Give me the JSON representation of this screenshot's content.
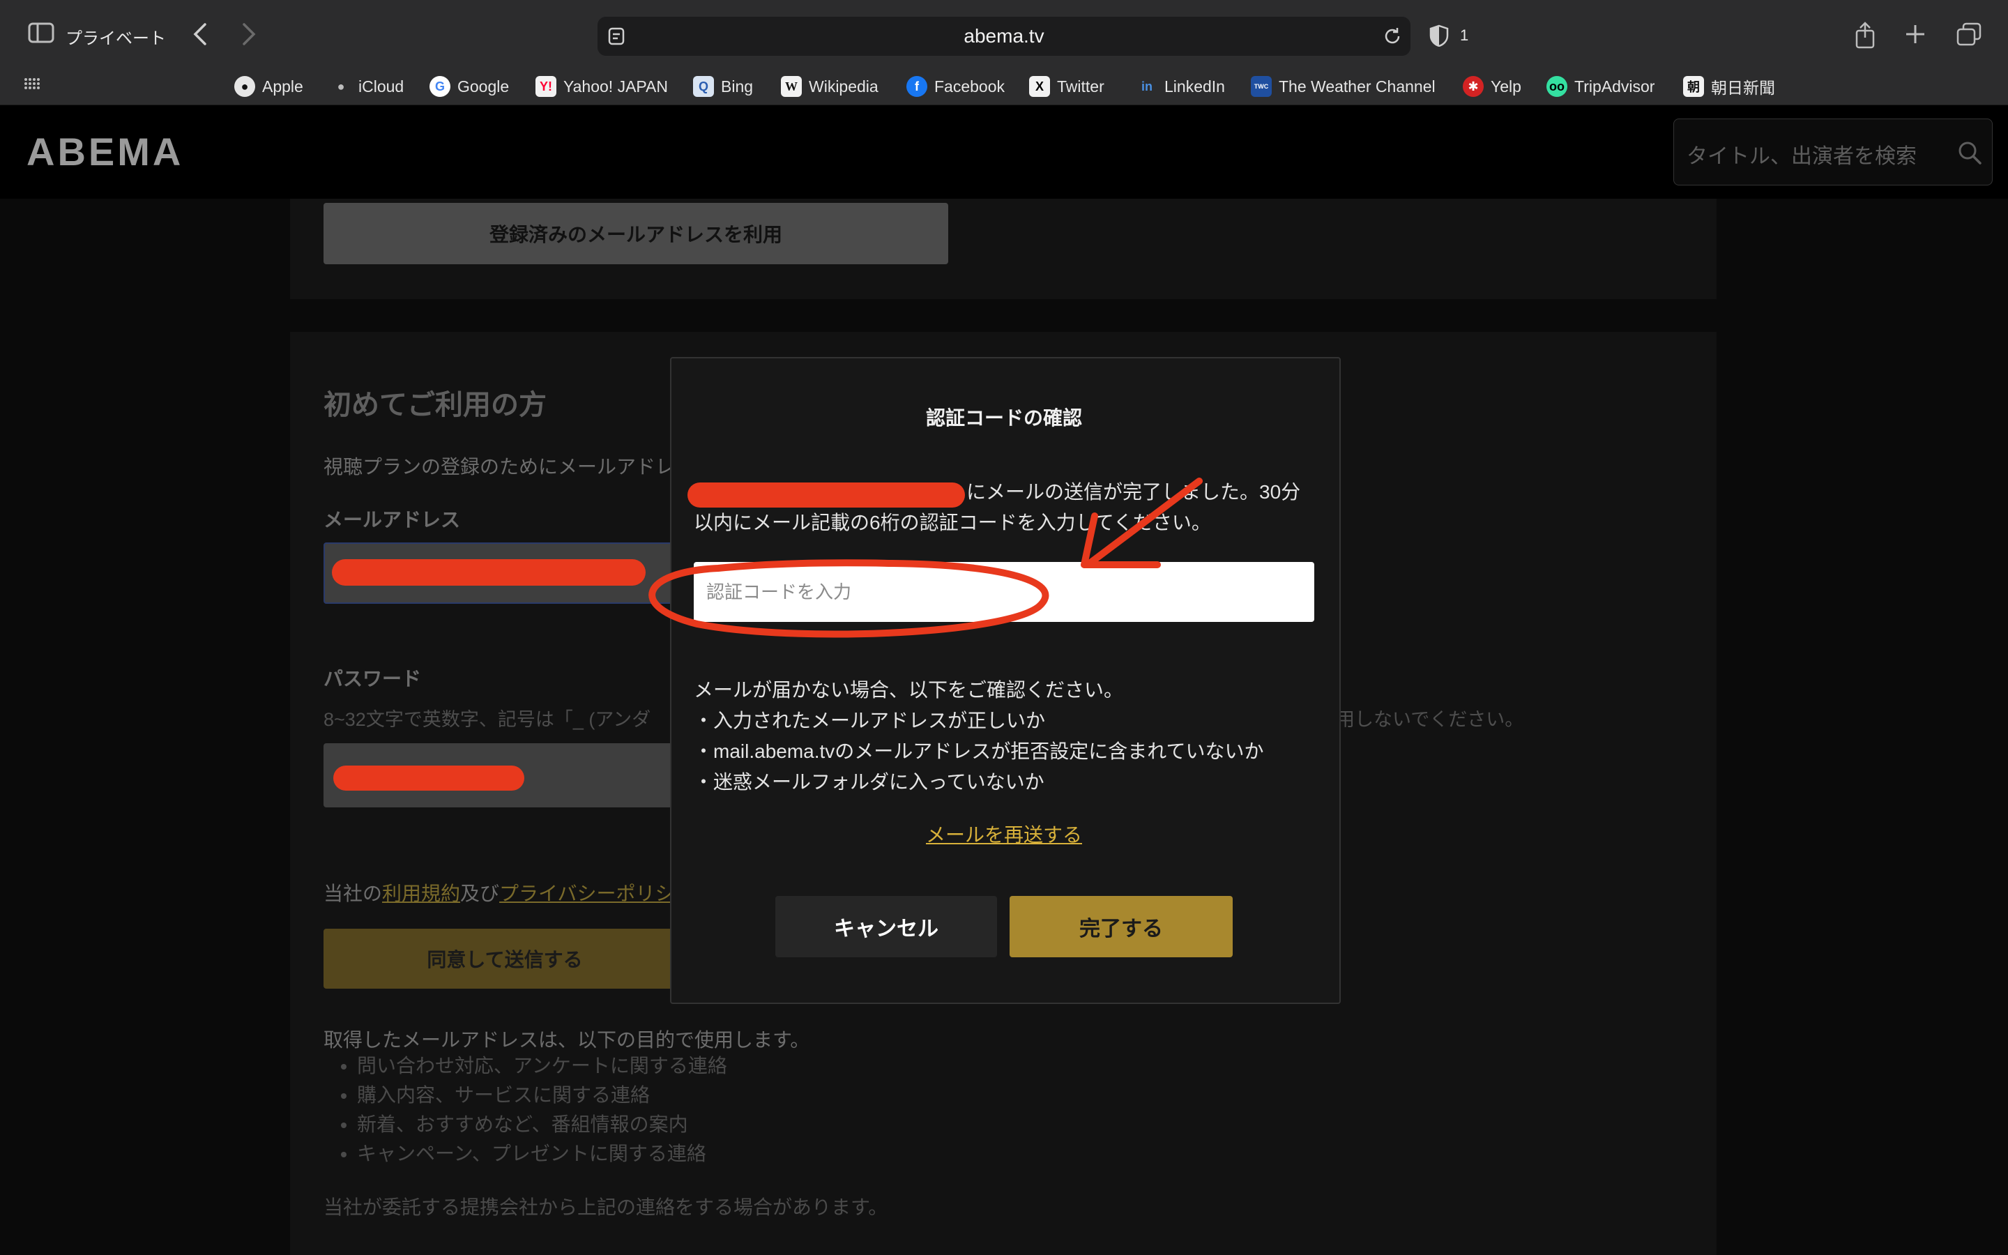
{
  "browser": {
    "profile_label": "プライベート",
    "url": "abema.tv",
    "tracker_count": "1",
    "bookmarks": [
      {
        "label": "Apple",
        "icon": "apple-icon"
      },
      {
        "label": "iCloud",
        "icon": "apple-icon"
      },
      {
        "label": "Google",
        "icon": "google-icon"
      },
      {
        "label": "Yahoo! JAPAN",
        "icon": "yahoo-icon"
      },
      {
        "label": "Bing",
        "icon": "bing-icon"
      },
      {
        "label": "Wikipedia",
        "icon": "wikipedia-icon"
      },
      {
        "label": "Facebook",
        "icon": "facebook-icon"
      },
      {
        "label": "Twitter",
        "icon": "twitter-icon"
      },
      {
        "label": "LinkedIn",
        "icon": "linkedin-icon"
      },
      {
        "label": "The Weather Channel",
        "icon": "weather-channel-icon"
      },
      {
        "label": "Yelp",
        "icon": "yelp-icon"
      },
      {
        "label": "TripAdvisor",
        "icon": "tripadvisor-icon"
      },
      {
        "label": "朝日新聞",
        "icon": "asahi-icon"
      }
    ]
  },
  "header": {
    "logo": "ABEMA",
    "search_placeholder": "タイトル、出演者を検索"
  },
  "page": {
    "existing_email_button": "登録済みのメールアドレスを利用",
    "new_user_title": "初めてご利用の方",
    "new_user_desc": "視聴プランの登録のためにメールアドレ",
    "email_label": "メールアドレス",
    "password_label": "パスワード",
    "password_hint": "8~32文字で英数字、記号は「_ (アンダ",
    "password_hint_tail": "用しないでください。",
    "terms_prefix": "当社の",
    "terms_link": "利用規約",
    "terms_and": "及び",
    "privacy_link": "プライバシーポリシ",
    "agree_button": "同意して送信する",
    "usage_intro": "取得したメールアドレスは、以下の目的で使用します。",
    "usage_items": [
      "問い合わせ対応、アンケートに関する連絡",
      "購入内容、サービスに関する連絡",
      "新着、おすすめなど、番組情報の案内",
      "キャンペーン、プレゼントに関する連絡"
    ],
    "partner_note": "当社が委託する提携会社から上記の連絡をする場合があります。"
  },
  "modal": {
    "title": "認証コードの確認",
    "sent_message_line1": "にメールの送信が完了しました。30分",
    "sent_message_line2": "以内にメール記載の6桁の認証コードを入力してください。",
    "code_placeholder": "認証コードを入力",
    "help_intro": "メールが届かない場合、以下をご確認ください。",
    "help_items": [
      "・入力されたメールアドレスが正しいか",
      "・mail.abema.tvのメールアドレスが拒否設定に含まれていないか",
      "・迷惑メールフォルダに入っていないか"
    ],
    "resend_link": "メールを再送する",
    "cancel_button": "キャンセル",
    "done_button": "完了する"
  },
  "colors": {
    "accent_gold": "#a8882e",
    "annotation_red": "#e8391d"
  }
}
